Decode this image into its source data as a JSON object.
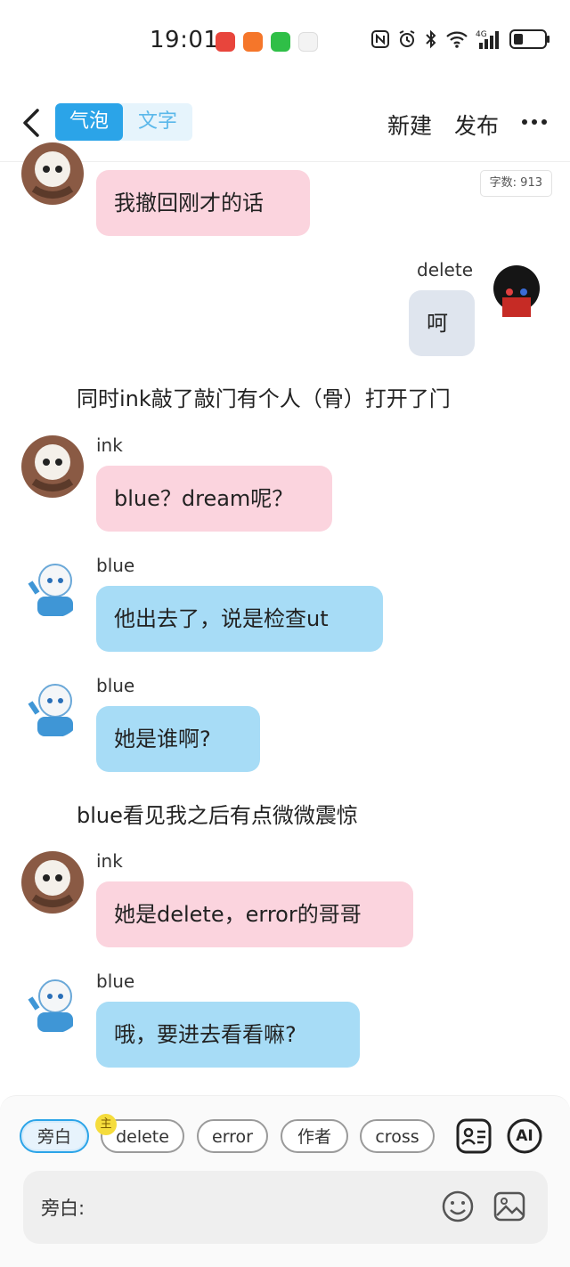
{
  "status_bar": {
    "time": "19:01",
    "icons": [
      "nfc-icon",
      "alarm-icon",
      "bluetooth-icon",
      "wifi-icon",
      "4g-signal-icon",
      "battery-icon"
    ],
    "network": "4G"
  },
  "header": {
    "back_icon": "chevron-left-icon",
    "mode_tabs": [
      "气泡",
      "文字"
    ],
    "active_tab": "气泡",
    "new_label": "新建",
    "publish_label": "发布",
    "more_icon": "more-horizontal-icon"
  },
  "word_count": "字数: 913",
  "messages": [
    {
      "type": "bubble",
      "side": "left",
      "speaker": "ink",
      "show_name": false,
      "text": "我撤回刚才的话",
      "color": "#fbd4de"
    },
    {
      "type": "bubble",
      "side": "right",
      "speaker": "delete",
      "show_name": true,
      "text": "呵",
      "color": "#dfe5ee"
    },
    {
      "type": "narration",
      "text": "同时ink敲了敲门有个人（骨）打开了门"
    },
    {
      "type": "bubble",
      "side": "left",
      "speaker": "ink",
      "show_name": true,
      "text": "blue？dream呢？",
      "color": "#fbd4de"
    },
    {
      "type": "bubble",
      "side": "left",
      "speaker": "blue",
      "show_name": true,
      "text": "他出去了，说是检查ut",
      "color": "#a7dcf6"
    },
    {
      "type": "bubble",
      "side": "left",
      "speaker": "blue",
      "show_name": true,
      "text": "她是谁啊?",
      "color": "#a7dcf6"
    },
    {
      "type": "narration",
      "text": "blue看见我之后有点微微震惊"
    },
    {
      "type": "bubble",
      "side": "left",
      "speaker": "ink",
      "show_name": true,
      "text": "她是delete，error的哥哥",
      "color": "#fbd4de"
    },
    {
      "type": "bubble",
      "side": "left",
      "speaker": "blue",
      "show_name": true,
      "text": "哦，要进去看看嘛?",
      "color": "#a7dcf6"
    }
  ],
  "characters": {
    "chips": [
      "旁白",
      "delete",
      "error",
      "作者",
      "cross"
    ],
    "selected": "旁白",
    "owner_badge": "主",
    "owner_of": "delete"
  },
  "tools": {
    "character_card_icon": "contact-card-icon",
    "ai_label": "AI"
  },
  "input": {
    "label": "旁白:",
    "emoji_icon": "emoji-icon",
    "image_icon": "image-icon"
  }
}
